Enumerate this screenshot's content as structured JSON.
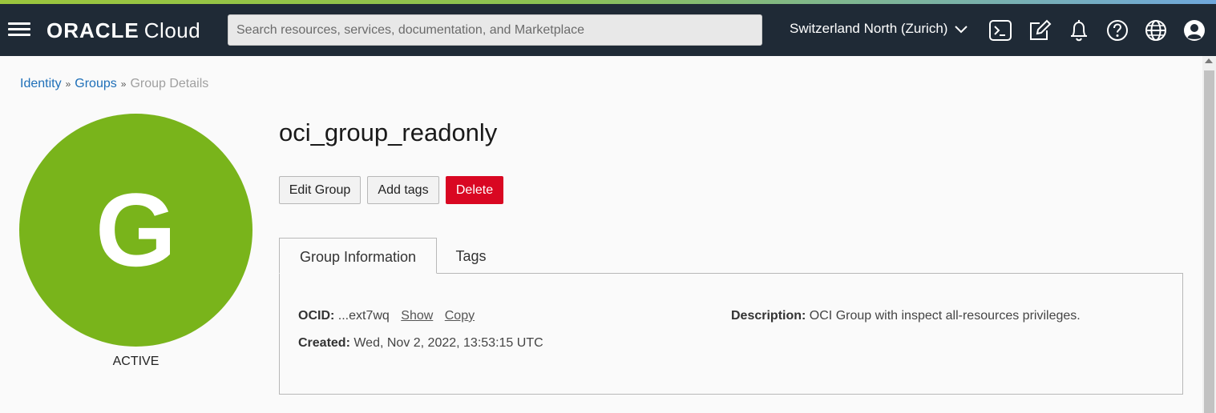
{
  "header": {
    "logo_brand": "ORACLE",
    "logo_product": "Cloud",
    "search_placeholder": "Search resources, services, documentation, and Marketplace",
    "region": "Switzerland North (Zurich)",
    "icons": [
      "cloud-shell-icon",
      "edit-icon",
      "bell-icon",
      "help-icon",
      "globe-icon",
      "profile-icon"
    ]
  },
  "breadcrumb": {
    "items": [
      "Identity",
      "Groups"
    ],
    "current": "Group Details",
    "separator": "»"
  },
  "group": {
    "avatar_letter": "G",
    "avatar_color": "#79b41b",
    "status": "ACTIVE",
    "name": "oci_group_readonly"
  },
  "actions": {
    "edit": "Edit Group",
    "add_tags": "Add tags",
    "delete": "Delete"
  },
  "tabs": [
    {
      "label": "Group Information",
      "active": true
    },
    {
      "label": "Tags",
      "active": false
    }
  ],
  "info": {
    "ocid_label": "OCID:",
    "ocid_value": "...ext7wq",
    "show_link": "Show",
    "copy_link": "Copy",
    "created_label": "Created:",
    "created_value": "Wed, Nov 2, 2022, 13:53:15 UTC",
    "description_label": "Description:",
    "description_value": "OCI Group with inspect all-resources privileges."
  },
  "colors": {
    "topbar": "#1f2a36",
    "link": "#1e6fb8",
    "danger": "#d90722"
  }
}
